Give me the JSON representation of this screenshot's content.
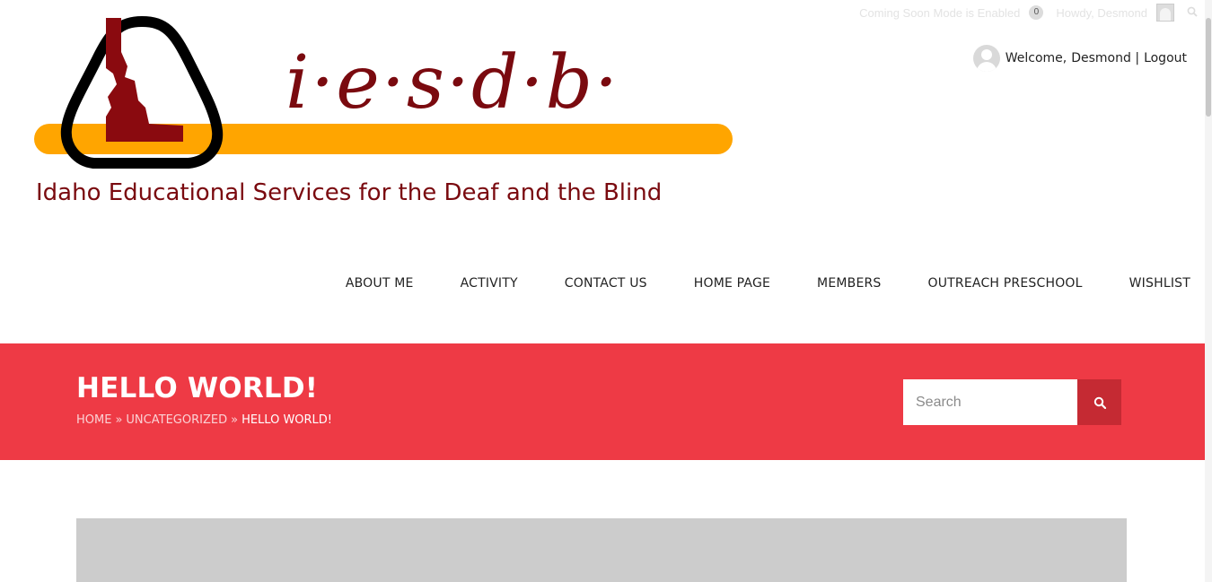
{
  "admin_bar": {
    "coming_soon": "Coming Soon Mode is Enabled",
    "notification_count": "0",
    "howdy": "Howdy, Desmond"
  },
  "logo": {
    "wordmark": "i·e·s·d·b·",
    "tagline": "Idaho Educational Services for the Deaf and the Blind",
    "colors": {
      "maroon": "#7a0a0f",
      "gold": "#ffa500",
      "outline": "#000000"
    }
  },
  "user": {
    "welcome": "Welcome,",
    "name": "Desmond |",
    "logout": "Logout"
  },
  "nav": {
    "items": [
      "ABOUT ME",
      "ACTIVITY",
      "CONTACT US",
      "HOME PAGE",
      "MEMBERS",
      "OUTREACH PRESCHOOL",
      "WISHLIST"
    ]
  },
  "banner": {
    "title": "HELLO WORLD!",
    "breadcrumb": {
      "home": "HOME",
      "category": "UNCATEGORIZED",
      "current": "HELLO WORLD!",
      "separator": "»"
    },
    "search_placeholder": "Search",
    "colors": {
      "background": "#ee3a45",
      "button": "#c52a33"
    }
  }
}
